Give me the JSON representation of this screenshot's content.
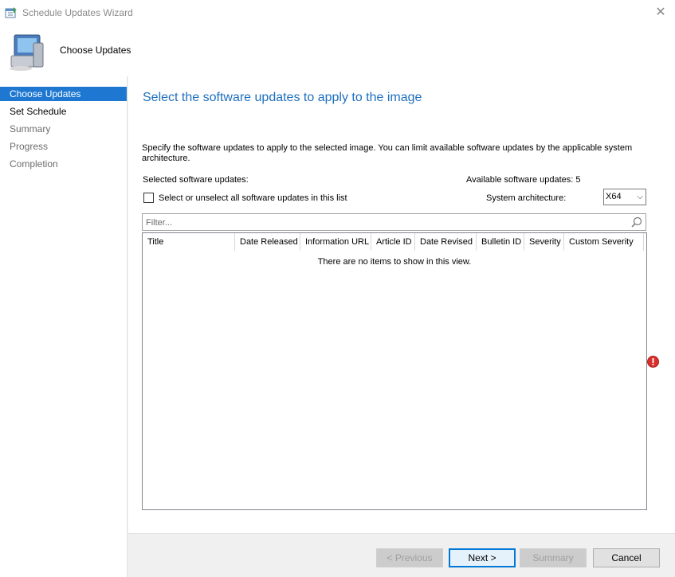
{
  "window": {
    "title": "Schedule Updates Wizard",
    "close_label": "✕"
  },
  "header": {
    "page_name": "Choose Updates"
  },
  "nav": {
    "items": [
      {
        "label": "Choose Updates",
        "state": "active"
      },
      {
        "label": "Set Schedule",
        "state": "done"
      },
      {
        "label": "Summary",
        "state": "pending"
      },
      {
        "label": "Progress",
        "state": "pending"
      },
      {
        "label": "Completion",
        "state": "pending"
      }
    ]
  },
  "main": {
    "title": "Select the software updates to apply to the image",
    "description": "Specify the software updates to apply to the selected image. You can limit available software updates by the applicable system architecture.",
    "selected_label": "Selected software updates:",
    "available_label": "Available software updates: 5",
    "select_all_label": "Select or unselect all software updates in this list",
    "select_all_checked": false,
    "arch_label": "System architecture:",
    "arch_value": "X64",
    "filter_placeholder": "Filter...",
    "grid": {
      "columns": [
        "Title",
        "Date Released",
        "Information URL",
        "Article ID",
        "Date Revised",
        "Bulletin ID",
        "Severity",
        "Custom Severity"
      ],
      "empty_message": "There are no items to show in this view."
    }
  },
  "buttons": {
    "previous": "< Previous",
    "next": "Next >",
    "summary": "Summary",
    "cancel": "Cancel"
  },
  "colors": {
    "accent": "#1e78d2",
    "title_blue": "#1e6fbf",
    "error": "#d9302c"
  },
  "icons": {
    "app": "wizard-calendar-icon",
    "header": "computer-icon",
    "search": "search-icon",
    "error": "error-icon"
  }
}
